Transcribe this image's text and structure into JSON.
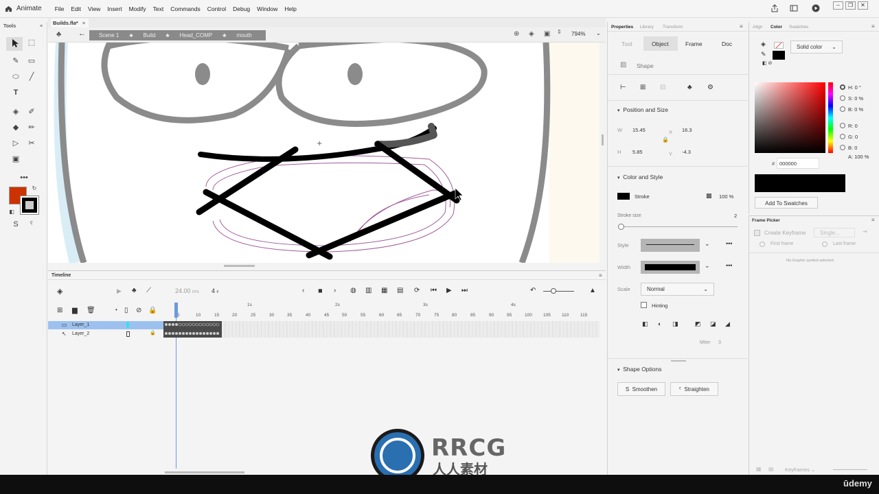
{
  "menubar": {
    "app_name": "Animate",
    "items": [
      "File",
      "Edit",
      "View",
      "Insert",
      "Modify",
      "Text",
      "Commands",
      "Control",
      "Debug",
      "Window",
      "Help"
    ]
  },
  "tools_panel": {
    "title": "Tools",
    "fill_color": "#cc3300",
    "stroke_color": "#000000"
  },
  "document": {
    "tab_label": "Builds.fla*",
    "breadcrumbs": [
      "Scene 1",
      "Build",
      "Head_COMP",
      "mouth"
    ],
    "zoom": "794%"
  },
  "timeline": {
    "title": "Timeline",
    "fps": "24.00",
    "fps_unit": "FPS",
    "current_frame": "4",
    "frame_unit": "F",
    "seconds_marks": [
      "1s",
      "2s",
      "3s",
      "4s"
    ],
    "frame_numbers": [
      "5",
      "10",
      "15",
      "20",
      "25",
      "30",
      "35",
      "40",
      "45",
      "50",
      "55",
      "60",
      "65",
      "70",
      "75",
      "80",
      "85",
      "90",
      "95",
      "100",
      "105",
      "110",
      "115"
    ],
    "layers": [
      {
        "name": "Layer_1",
        "selected": true
      },
      {
        "name": "Layer_2",
        "selected": false
      }
    ]
  },
  "properties": {
    "tabs": [
      "Properties",
      "Library",
      "Transform"
    ],
    "subtabs": [
      "Tool",
      "Object",
      "Frame",
      "Doc"
    ],
    "active_subtab": "Object",
    "object_type": "Shape",
    "position_size": {
      "header": "Position and Size",
      "w_label": "W",
      "w": "15.45",
      "h_label": "H",
      "h": "5.85",
      "x_label": "X",
      "x": "16.3",
      "y_label": "Y",
      "y": "-4.3"
    },
    "color_style": {
      "header": "Color and Style",
      "stroke_label": "Stroke",
      "stroke_color": "#000000",
      "alpha": "100 %",
      "stroke_size_label": "Stroke size",
      "stroke_size": "2",
      "style_label": "Style",
      "width_label": "Width",
      "scale_label": "Scale",
      "scale_value": "Normal",
      "hinting_label": "Hinting",
      "miter_label": "Miter",
      "miter_value": "3"
    },
    "shape_options": {
      "header": "Shape Options",
      "smoothen": "Smoothen",
      "straighten": "Straighten"
    }
  },
  "color_panel": {
    "tabs": [
      "Align",
      "Color",
      "Swatches"
    ],
    "fill_type": "Solid color",
    "h_label": "H:",
    "h": "0 °",
    "s_label": "S:",
    "s": "0 %",
    "b_label": "B:",
    "b": "0 %",
    "r_label": "R:",
    "r": "0",
    "g_label": "G:",
    "g": "0",
    "b2_label": "B:",
    "b2": "0",
    "a_label": "A:",
    "a": "100 %",
    "hex_label": "#",
    "hex": "000000",
    "add_swatch": "Add To Swatches"
  },
  "frame_picker": {
    "title": "Frame Picker",
    "create_keyframe": "Create Keyframe",
    "single": "Single...",
    "first_frame": "First frame",
    "last_frame": "Last frame",
    "empty_msg": "No Graphic symbol selected",
    "keyframes": "Keyframes"
  },
  "watermark": {
    "brand": "RRCG",
    "sub": "人人素材"
  },
  "udemy": "ūdemy"
}
